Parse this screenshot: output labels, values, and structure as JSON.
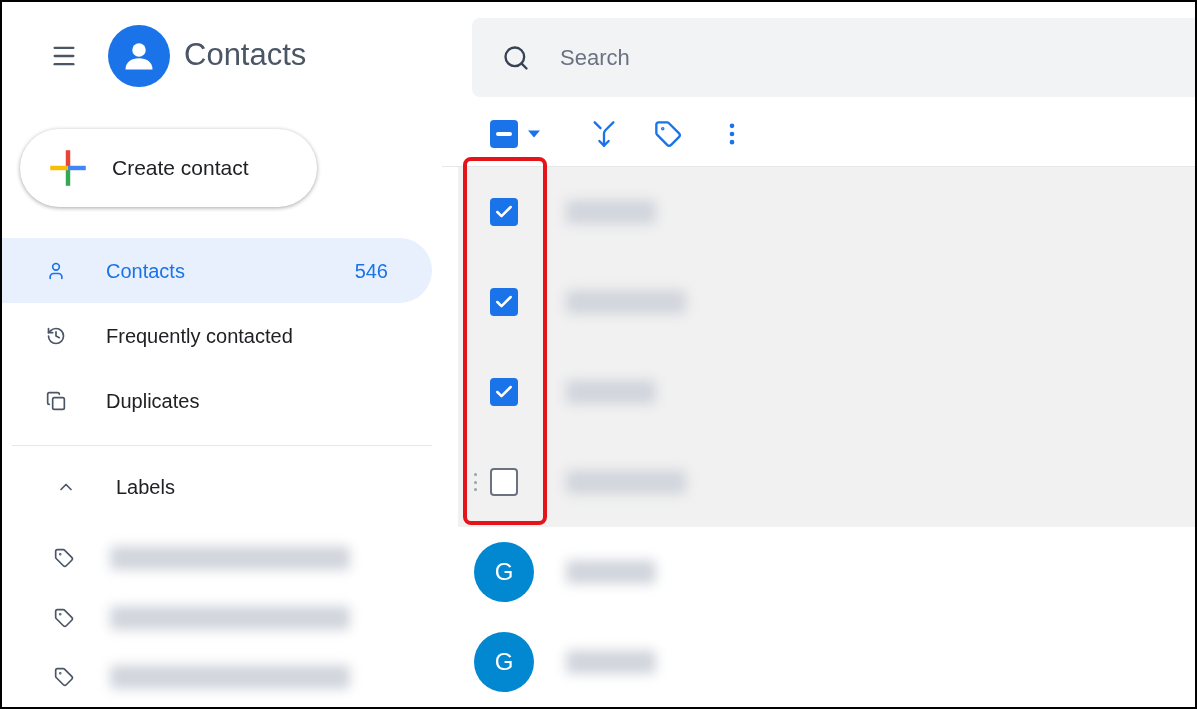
{
  "app": {
    "title": "Contacts"
  },
  "search": {
    "placeholder": "Search"
  },
  "create_button": {
    "label": "Create contact"
  },
  "nav": [
    {
      "label": "Contacts",
      "count": "546",
      "selected": true,
      "kind": "person"
    },
    {
      "label": "Frequently contacted",
      "selected": false,
      "kind": "history"
    },
    {
      "label": "Duplicates",
      "selected": false,
      "kind": "copy"
    }
  ],
  "labels_section": {
    "title": "Labels",
    "expanded": true,
    "items": [
      {
        "kind": "redacted"
      },
      {
        "kind": "redacted"
      },
      {
        "kind": "redacted"
      }
    ]
  },
  "toolbar": {
    "select_all": {
      "indeterminate": true
    }
  },
  "rows": [
    {
      "kind": "checkbox",
      "checked": true
    },
    {
      "kind": "checkbox",
      "checked": true
    },
    {
      "kind": "checkbox",
      "checked": true
    },
    {
      "kind": "checkbox",
      "checked": false
    },
    {
      "kind": "avatar",
      "initial": "G"
    },
    {
      "kind": "avatar",
      "initial": "G"
    }
  ]
}
